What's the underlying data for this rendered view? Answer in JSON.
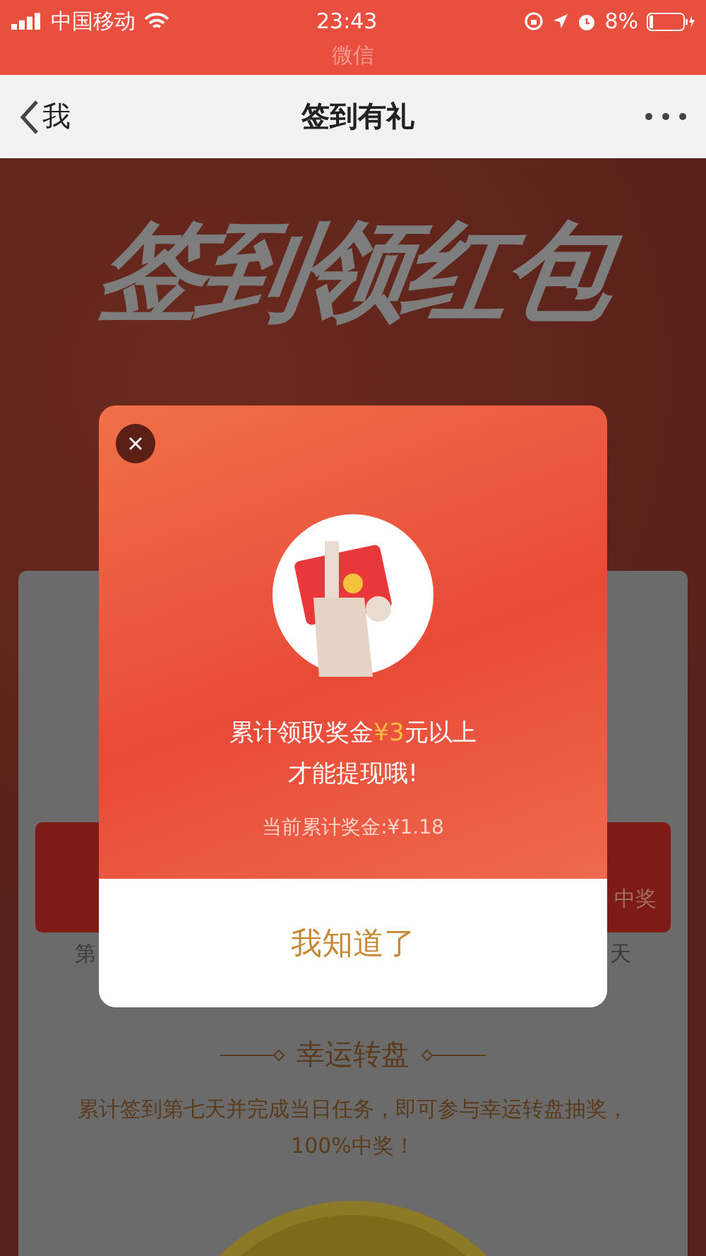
{
  "status_bar": {
    "carrier": "中国移动",
    "time": "23:43",
    "battery": "8%",
    "app_label": "微信"
  },
  "nav": {
    "back_label": "我",
    "title": "签到有礼"
  },
  "page": {
    "banner_title": "签到领红包",
    "envelopes": [
      {
        "caption": "第"
      },
      {
        "caption": "天",
        "badge": "中奖"
      }
    ],
    "lucky_wheel": {
      "heading": "幸运转盘",
      "description": "累计签到第七天并完成当日任务，即可参与幸运转盘抽奖，100%中奖！"
    }
  },
  "dialog": {
    "message_before": "累计领取奖金",
    "amount": "¥3",
    "message_after": "元以上",
    "message_line_2": "才能提现哦!",
    "current_total": "当前累计奖金:¥1.18",
    "button": "我知道了"
  }
}
